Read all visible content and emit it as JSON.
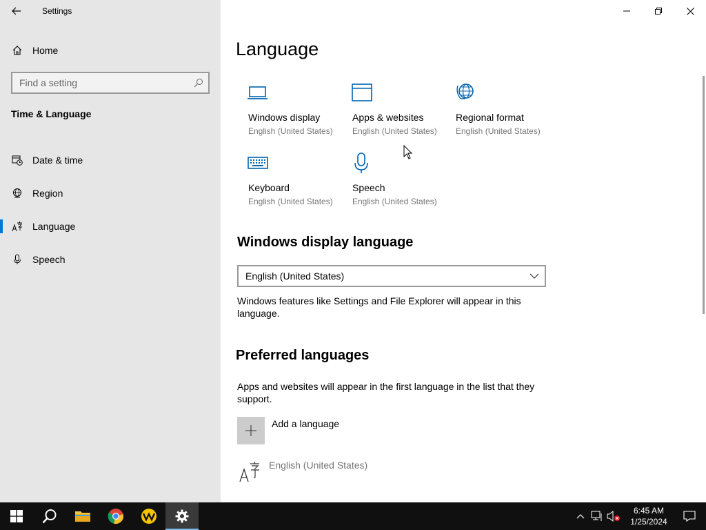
{
  "window": {
    "title": "Settings"
  },
  "sidebar": {
    "home_label": "Home",
    "search_placeholder": "Find a setting",
    "section": "Time & Language",
    "items": [
      {
        "label": "Date & time",
        "icon": "date-time-icon"
      },
      {
        "label": "Region",
        "icon": "globe-icon"
      },
      {
        "label": "Language",
        "icon": "language-icon",
        "active": true
      },
      {
        "label": "Speech",
        "icon": "microphone-icon"
      }
    ]
  },
  "main": {
    "title": "Language",
    "tiles": [
      {
        "label": "Windows display",
        "sub": "English (United States)",
        "icon": "laptop-icon"
      },
      {
        "label": "Apps & websites",
        "sub": "English (United States)",
        "icon": "window-icon"
      },
      {
        "label": "Regional format",
        "sub": "English (United States)",
        "icon": "globe-icon"
      },
      {
        "label": "Keyboard",
        "sub": "English (United States)",
        "icon": "keyboard-icon"
      },
      {
        "label": "Speech",
        "sub": "English (United States)",
        "icon": "microphone-icon"
      }
    ],
    "display_language": {
      "heading": "Windows display language",
      "selected": "English (United States)",
      "description": "Windows features like Settings and File Explorer will appear in this language."
    },
    "preferred": {
      "heading": "Preferred languages",
      "description": "Apps and websites will appear in the first language in the list that they support.",
      "add_label": "Add a language",
      "languages": [
        "English (United States)"
      ]
    }
  },
  "taskbar": {
    "time": "6:45 AM",
    "date": "1/25/2024",
    "accent": "#0078d7"
  }
}
